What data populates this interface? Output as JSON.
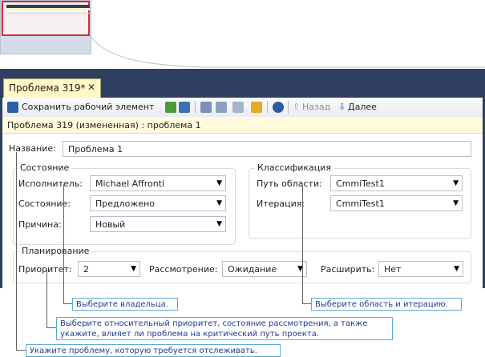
{
  "window": {
    "tab_title": "Проблема 319*",
    "tab_close": "✕"
  },
  "toolbar": {
    "save_label": "Сохранить рабочий элемент",
    "back_label": "Назад",
    "next_label": "Далее"
  },
  "info_bar": "Проблема 319 (измененная) : проблема 1",
  "form": {
    "title_label": "Название:",
    "title_value": "Проблема 1",
    "status_group": "Состояние",
    "assigned_label": "Исполнитель:",
    "assigned_value": "Michael Affronti",
    "state_label": "Состояние:",
    "state_value": "Предложено",
    "reason_label": "Причина:",
    "reason_value": "Новый",
    "class_group": "Классификация",
    "area_label": "Путь области:",
    "area_value": "CmmiTest1",
    "iteration_label": "Итерация:",
    "iteration_value": "CmmiTest1",
    "planning_group": "Планирование",
    "priority_label": "Приоритет:",
    "priority_value": "2",
    "triage_label": "Рассмотрение:",
    "triage_value": "Ожидание",
    "escalate_label": "Расширить:",
    "escalate_value": "Нет"
  },
  "callouts": {
    "owner": "Выберите владельца.",
    "area": "Выберите область и итерацию.",
    "priority": "Выберите относительный приоритет, состояние рассмотрения, а также укажите, влияет ли проблема на критический путь проекта.",
    "issue": "Укажите проблему, которую требуется отслеживать."
  },
  "colors": {
    "window_frame": "#2e3f60",
    "tab_active": "#fff7c5",
    "info_bar": "#fffbdc",
    "callout_border": "#5aa8d8",
    "callout_text": "#1f3a93"
  }
}
